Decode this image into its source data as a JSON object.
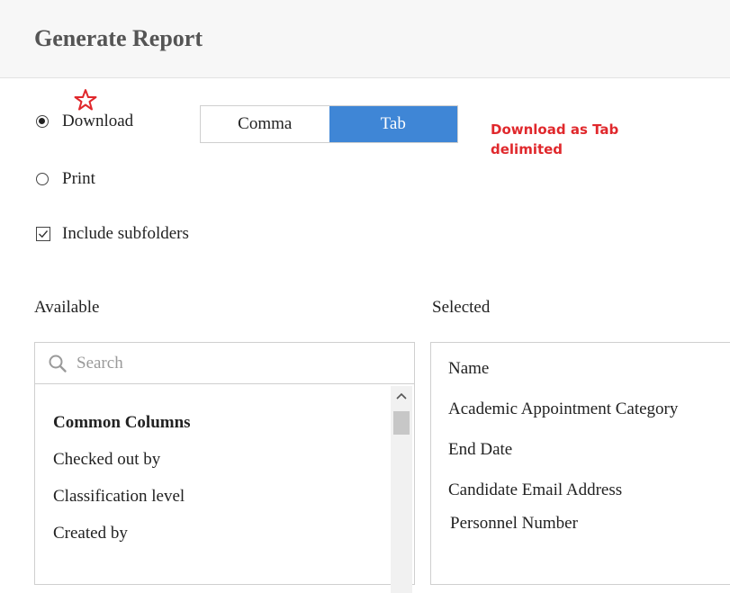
{
  "header": {
    "title": "Generate Report"
  },
  "options": {
    "download_label": "Download",
    "print_label": "Print",
    "include_subfolders_label": "Include subfolders",
    "download_selected": true,
    "include_subfolders_checked": true
  },
  "delimiter": {
    "options": [
      "Comma",
      "Tab"
    ],
    "selected": "Tab"
  },
  "annotation": {
    "text": "Download as Tab delimited",
    "color": "#e0282c",
    "marker": "star-icon"
  },
  "available": {
    "label": "Available",
    "search_placeholder": "Search",
    "items": [
      {
        "label": "Common Columns",
        "header": true
      },
      {
        "label": "Checked out by"
      },
      {
        "label": "Classification level"
      },
      {
        "label": "Created by"
      }
    ]
  },
  "selected": {
    "label": "Selected",
    "items": [
      "Name",
      "Academic Appointment Category",
      "End Date",
      "Candidate Email Address",
      "Personnel Number"
    ]
  },
  "colors": {
    "accent": "#3f86d6",
    "header_bg": "#f7f7f7",
    "border": "#cfcfcf"
  }
}
